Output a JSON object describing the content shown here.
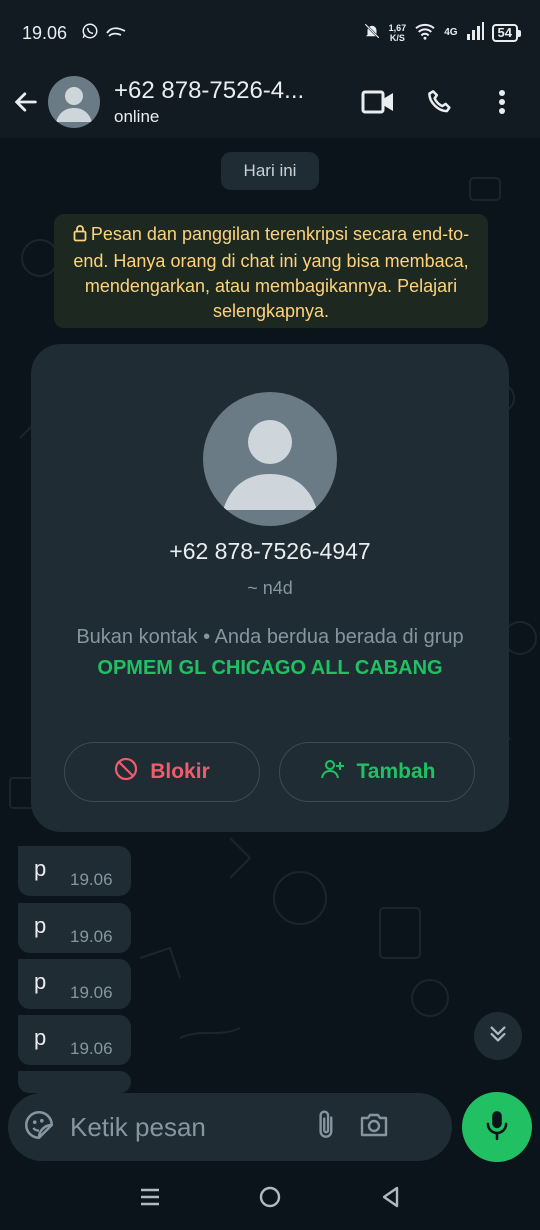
{
  "status_bar": {
    "time": "19.06",
    "speed_value": "1,67",
    "speed_unit": "K/S",
    "network": "4G",
    "battery": "54"
  },
  "header": {
    "contact_name": "+62 878-7526-4...",
    "status": "online"
  },
  "chat": {
    "date_chip": "Hari ini",
    "encryption_notice": "Pesan dan panggilan terenkripsi secara end-to-end. Hanya orang di chat ini yang bisa membaca, mendengarkan, atau membagikannya. Pelajari selengkapnya.",
    "contact_card": {
      "phone": "+62 878-7526-4947",
      "nickname": "~ n4d",
      "info_prefix": "Bukan kontak • Anda berdua berada di grup",
      "group_name": "OPMEM GL CHICAGO ALL CABANG",
      "block_label": "Blokir",
      "add_label": "Tambah"
    },
    "messages": [
      {
        "text": "p",
        "time": "19.06"
      },
      {
        "text": "p",
        "time": "19.06"
      },
      {
        "text": "p",
        "time": "19.06"
      },
      {
        "text": "p",
        "time": "19.06"
      }
    ]
  },
  "input": {
    "placeholder": "Ketik pesan"
  },
  "colors": {
    "accent_green": "#21c063",
    "danger_red": "#f15c6d",
    "notice_yellow": "#ffd279",
    "bubble": "#1f2c33",
    "background": "#0b141a"
  },
  "icons": [
    "whatsapp-icon",
    "sun-chat-icon",
    "mute-bell-icon",
    "wifi-icon",
    "signal-icon",
    "battery-icon",
    "back-arrow-icon",
    "video-call-icon",
    "phone-call-icon",
    "more-vertical-icon",
    "lock-icon",
    "block-icon",
    "add-person-icon",
    "double-chevron-down-icon",
    "sticker-icon",
    "paperclip-icon",
    "camera-icon",
    "microphone-icon",
    "recents-icon",
    "home-icon",
    "back-icon"
  ]
}
